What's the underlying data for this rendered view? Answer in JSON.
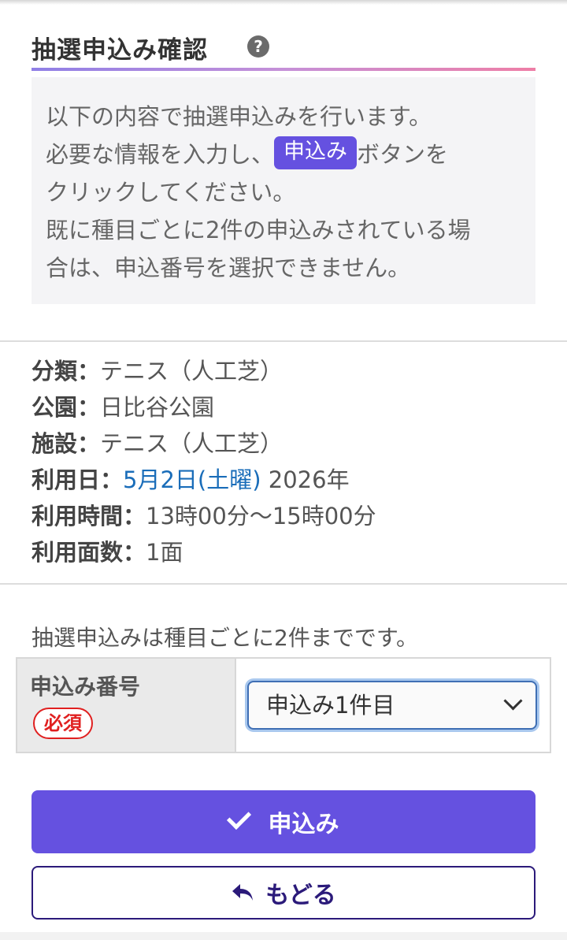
{
  "header": {
    "title": "抽選申込み確認",
    "help_icon": "question-circle-icon"
  },
  "info": {
    "line1": "以下の内容で抽選申込みを行います。",
    "line2_before": "必要な情報を入力し、",
    "line2_badge": "申込み",
    "line2_after": "ボタンを",
    "line3": "クリックしてください。",
    "line4": "既に種目ごとに2件の申込みされている場",
    "line5": "合は、申込番号を選択できません。"
  },
  "details": {
    "category_label": "分類：",
    "category_value": "テニス（人工芝）",
    "park_label": "公園：",
    "park_value": "日比谷公園",
    "facility_label": "施設：",
    "facility_value": "テニス（人工芝）",
    "date_label": "利用日：",
    "date_link": "5月2日(土曜)",
    "date_year": " 2026年",
    "time_label": "利用時間：",
    "time_value": "13時00分～15時00分",
    "courts_label": "利用面数：",
    "courts_value": "1面"
  },
  "limit_note": "抽選申込みは種目ごとに2件までです。",
  "form": {
    "label": "申込み番号",
    "required": "必須",
    "selected": "申込み1件目"
  },
  "buttons": {
    "apply": "申込み",
    "back": "もどる"
  },
  "colors": {
    "accent": "#6551e0",
    "back_border": "#2b1a7a",
    "link": "#1a6db9",
    "required": "#e02020"
  }
}
